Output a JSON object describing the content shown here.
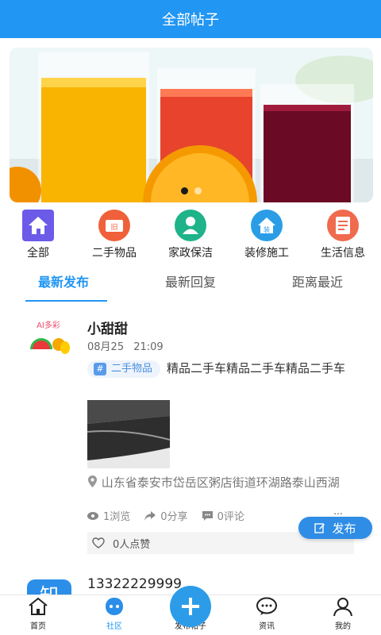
{
  "header": {
    "title": "全部帖子"
  },
  "banner": {
    "slides": 2,
    "active": 1
  },
  "categories": [
    {
      "label": "全部",
      "icon": "home-icon",
      "color": "#6b5be8"
    },
    {
      "label": "二手物品",
      "icon": "secondhand-ticket-icon",
      "color": "#f0603a"
    },
    {
      "label": "家政保洁",
      "icon": "housekeeping-person-icon",
      "color": "#1fb38a"
    },
    {
      "label": "装修施工",
      "icon": "renovation-house-icon",
      "color": "#2a9de6"
    },
    {
      "label": "生活信息",
      "icon": "life-info-document-icon",
      "color": "#f06a4e"
    }
  ],
  "tabs": [
    {
      "label": "最新发布",
      "active": true
    },
    {
      "label": "最新回复",
      "active": false
    },
    {
      "label": "距离最近",
      "active": false
    }
  ],
  "posts": [
    {
      "user": "小甜甜",
      "time": "08月25 21:09",
      "tag_hash": "#",
      "tag": "二手物品",
      "content": "精品二手车精品二手车精品二手车",
      "location": "山东省泰安市岱岳区粥店街道环湖路泰山西湖",
      "views": "1浏览",
      "shares": "0分享",
      "comments": "0评论",
      "more": "...",
      "likes": "0人点赞"
    },
    {
      "user": "13322229999",
      "avatar_text": "知"
    }
  ],
  "floating_publish": {
    "label": "发布"
  },
  "bottom_nav": [
    {
      "label": "首页",
      "icon": "home-outline-icon",
      "active": false
    },
    {
      "label": "社区",
      "icon": "community-icon",
      "active": true
    },
    {
      "label": "发布帖子",
      "icon": "plus-icon",
      "active": false
    },
    {
      "label": "资讯",
      "icon": "chat-bubble-icon",
      "active": false
    },
    {
      "label": "我的",
      "icon": "user-icon",
      "active": false
    }
  ],
  "colors": {
    "primary": "#2196f3",
    "floating_button": "#2f8de6"
  }
}
